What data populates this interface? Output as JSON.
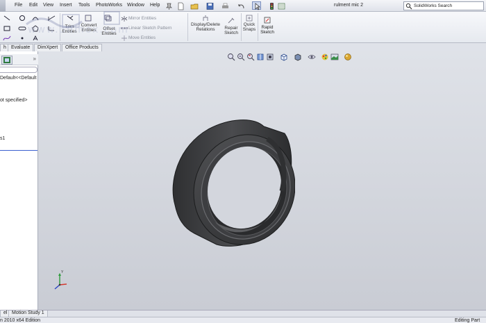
{
  "menubar": {
    "items": [
      "File",
      "Edit",
      "View",
      "Insert",
      "Tools",
      "PhotoWorks",
      "Window",
      "Help"
    ],
    "document_title": "rulment mic 2",
    "search_placeholder": "SolidWorks Search"
  },
  "ribbon": {
    "trim_label": [
      "Trim",
      "Entities"
    ],
    "convert_label": [
      "Convert",
      "Entities"
    ],
    "offset_label": [
      "Offset",
      "Entities"
    ],
    "mirror_label": "Mirror Entities",
    "linear_pattern_label": "Linear Sketch Pattern",
    "move_label": "Move Entities",
    "relations_label": [
      "Display/Delete",
      "Relations"
    ],
    "repair_label": [
      "Repair",
      "Sketch"
    ],
    "quick_snaps_label": [
      "Quick",
      "Snaps"
    ],
    "rapid_sketch_label": [
      "Rapid",
      "Sketch"
    ]
  },
  "watermark": "www.3dmox.com",
  "tabs": [
    "h",
    "Evaluate",
    "DimXpert",
    "Office Products"
  ],
  "feature_tree": {
    "expand_symbol": "»",
    "items": [
      "Default<<Default",
      "ot specified>",
      "s1"
    ]
  },
  "bottom_tabs": [
    "el",
    "Motion Study 1"
  ],
  "status": {
    "left": "n 2010 x64 Edition",
    "right": "Editing Part"
  },
  "colors": {
    "viewport_top": "#dfe2e8",
    "viewport_bottom": "#c9ccd4",
    "model_body": "#3b3c3e",
    "selection_blue": "#3a5fcf"
  },
  "icons": [
    "line-icon",
    "circle-icon",
    "arc-icon",
    "rectangle-icon",
    "spline-icon",
    "trim-icon",
    "convert-icon",
    "offset-icon",
    "mirror-icon",
    "pattern-icon",
    "move-icon",
    "relations-icon",
    "repair-icon",
    "snaps-icon",
    "rapid-sketch-icon",
    "search-icon",
    "zoom-fit-icon",
    "zoom-area-icon",
    "previous-view-icon",
    "section-view-icon",
    "view-orientation-icon",
    "display-style-icon",
    "hide-show-icon",
    "edit-appearance-icon",
    "apply-scene-icon"
  ]
}
